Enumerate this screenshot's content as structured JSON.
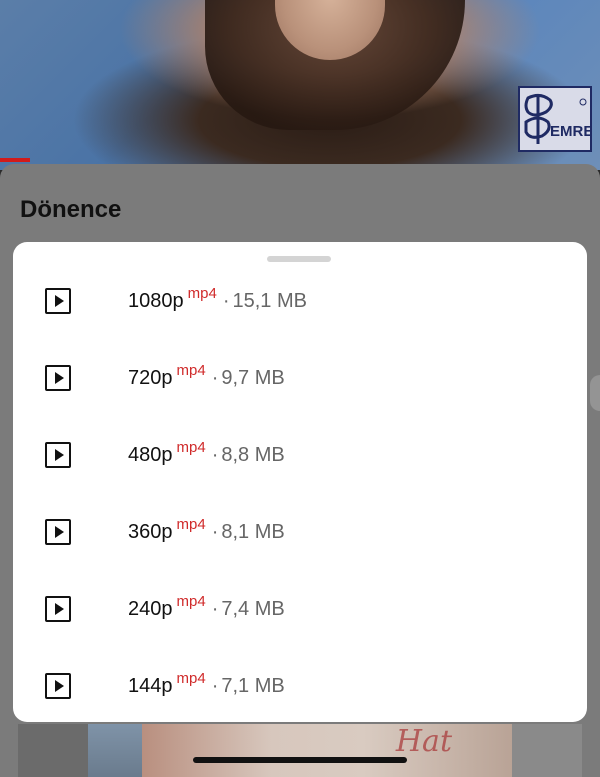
{
  "background": {
    "logo_text": "EMRE"
  },
  "sheet": {
    "title": "Dönence"
  },
  "formats": [
    {
      "resolution": "1080p",
      "ext": "mp4",
      "separator": "·",
      "size": "15,1 MB"
    },
    {
      "resolution": "720p",
      "ext": "mp4",
      "separator": "·",
      "size": "9,7 MB"
    },
    {
      "resolution": "480p",
      "ext": "mp4",
      "separator": "·",
      "size": "8,8 MB"
    },
    {
      "resolution": "360p",
      "ext": "mp4",
      "separator": "·",
      "size": "8,1 MB"
    },
    {
      "resolution": "240p",
      "ext": "mp4",
      "separator": "·",
      "size": "7,4 MB"
    },
    {
      "resolution": "144p",
      "ext": "mp4",
      "separator": "·",
      "size": "7,1 MB"
    }
  ],
  "icons": {
    "row_icon": "play-box-icon"
  },
  "colors": {
    "accent": "#d02b2b",
    "sheet_bg": "#ffffff",
    "overlay": "#7b7b7b"
  }
}
